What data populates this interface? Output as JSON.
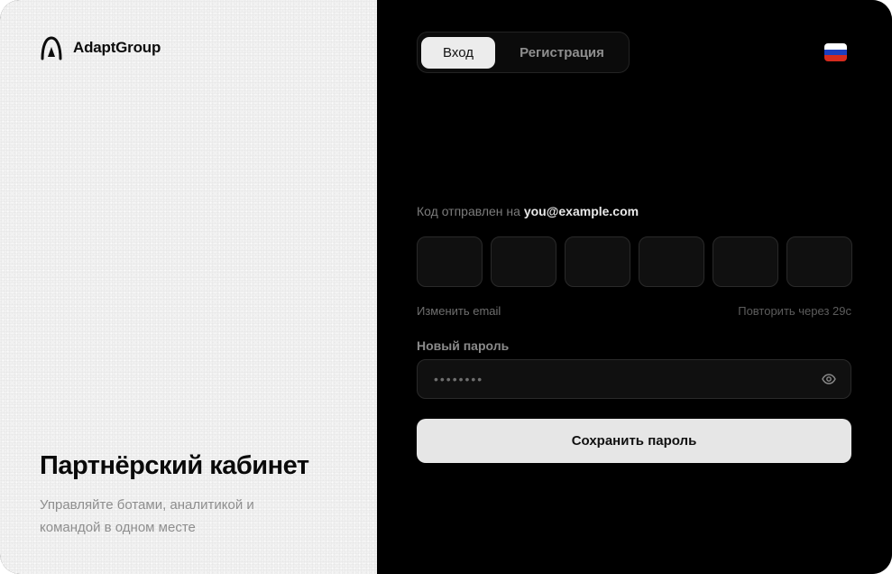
{
  "brand": {
    "name": "AdaptGroup",
    "logo_icon": "adapt-logo-icon"
  },
  "hero": {
    "title": "Партнёрский кабинет",
    "subtitle": "Управляйте ботами, аналитикой и командой в одном месте"
  },
  "tabs": [
    {
      "label": "Вход",
      "active": true
    },
    {
      "label": "Регистрация",
      "active": false
    }
  ],
  "language": {
    "icon": "russia-flag-icon",
    "colors": [
      "#ffffff",
      "#1c3fbf",
      "#d52b1e"
    ]
  },
  "verification": {
    "sent_prefix": "Код отправлен на",
    "email": "you@example.com",
    "code_digits": [
      "",
      "",
      "",
      "",
      "",
      ""
    ],
    "change_email_label": "Изменить email",
    "resend_label": "Повторить через 29с"
  },
  "password": {
    "label": "Новый пароль",
    "placeholder": "••••••••",
    "value": "",
    "toggle_icon": "eye-icon"
  },
  "save_button": {
    "label": "Сохранить пароль"
  },
  "colors": {
    "left_panel": "#f1f1f1",
    "right_panel": "#000000",
    "button": "#e6e6e6"
  }
}
